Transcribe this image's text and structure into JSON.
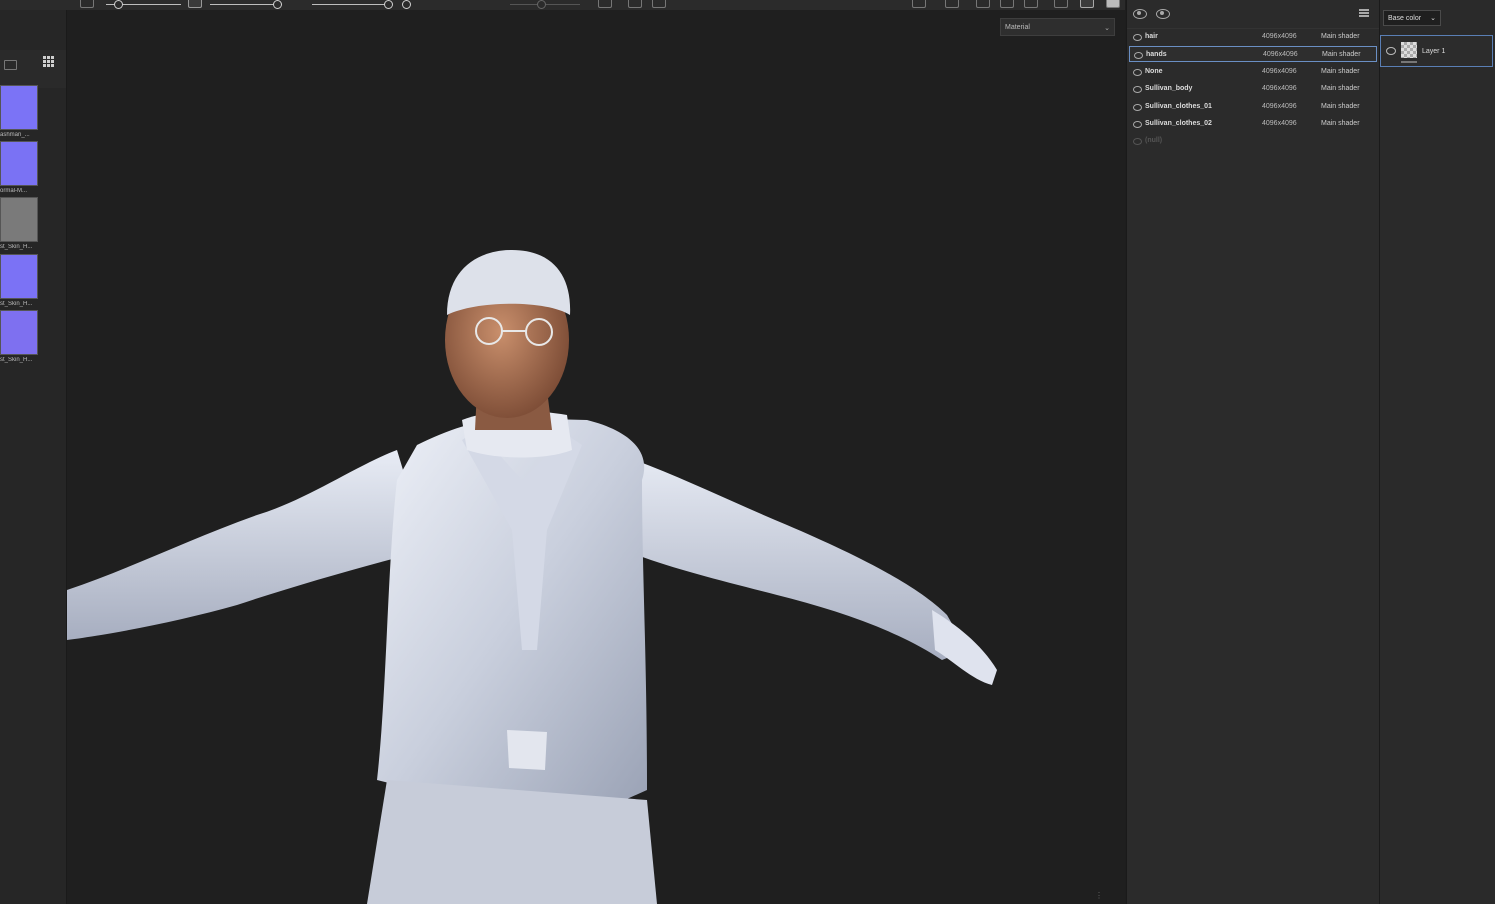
{
  "viewport": {
    "mode_label": "Material",
    "mode_chevron": "⌄"
  },
  "texture_shelf": {
    "items": [
      {
        "label": "ashman_...",
        "color": "#7b73f6"
      },
      {
        "label": "ormal-M...",
        "color": "#7a72f4"
      },
      {
        "label": "st_Skin_H...",
        "color": "#7a7a7a"
      },
      {
        "label": "st_Skin_H...",
        "color": "#7b72f5"
      },
      {
        "label": "st_Skin_H...",
        "color": "#7e70f0"
      }
    ]
  },
  "texture_sets": {
    "rows": [
      {
        "name": "hair",
        "resolution": "4096x4096",
        "shader": "Main shader"
      },
      {
        "name": "hands",
        "resolution": "4096x4096",
        "shader": "Main shader"
      },
      {
        "name": "None",
        "resolution": "4096x4096",
        "shader": "Main shader"
      },
      {
        "name": "Sullivan_body",
        "resolution": "4096x4096",
        "shader": "Main shader"
      },
      {
        "name": "Sullivan_clothes_01",
        "resolution": "4096x4096",
        "shader": "Main shader"
      },
      {
        "name": "Sullivan_clothes_02",
        "resolution": "4096x4096",
        "shader": "Main shader"
      },
      {
        "name": "(null)",
        "resolution": "",
        "shader": ""
      }
    ],
    "selected": "hands"
  },
  "layers": {
    "channel": "Base color",
    "channel_chevron": "⌄",
    "items": [
      {
        "name": "Layer 1"
      }
    ]
  },
  "colors": {
    "accent": "#6a8fc4",
    "panel_bg": "#2b2b2b",
    "viewport_bg": "#1f1f1f"
  }
}
